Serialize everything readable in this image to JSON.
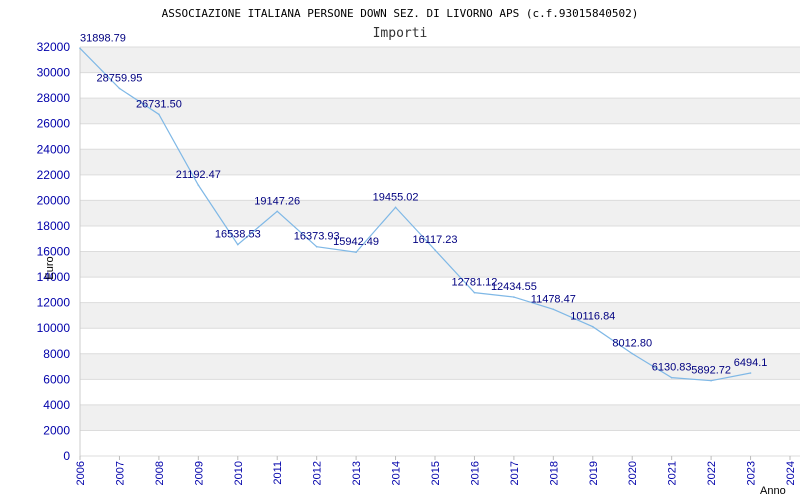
{
  "chart_data": {
    "type": "line",
    "title": "ASSOCIAZIONE ITALIANA PERSONE DOWN SEZ. DI LIVORNO APS (c.f.93015840502)",
    "subtitle": "Importi",
    "xlabel": "Anno",
    "ylabel": "Euro",
    "ylim": [
      0,
      32000
    ],
    "y_ticks": [
      0,
      2000,
      4000,
      6000,
      8000,
      10000,
      12000,
      14000,
      16000,
      18000,
      20000,
      22000,
      24000,
      26000,
      28000,
      30000,
      32000
    ],
    "grid": true,
    "legend": "none",
    "x": [
      "2006",
      "2007",
      "2008",
      "2009",
      "2010",
      "2011",
      "2012",
      "2013",
      "2014",
      "2015",
      "2016",
      "2017",
      "2018",
      "2019",
      "2020",
      "2021",
      "2022",
      "2023",
      "2024"
    ],
    "series": [
      {
        "values": [
          31898.79,
          28759.95,
          26731.5,
          21192.47,
          16538.53,
          19147.26,
          16373.93,
          15942.49,
          19455.02,
          16117.23,
          12781.12,
          12434.55,
          11478.47,
          10116.84,
          8012.8,
          6130.83,
          5892.72,
          6494.1
        ],
        "labels": [
          "31898.79",
          "28759.95",
          "26731.50",
          "21192.47",
          "16538.53",
          "19147.26",
          "16373.93",
          "15942.49",
          "19455.02",
          "16117.23",
          "12781.12",
          "12434.55",
          "11478.47",
          "10116.84",
          "8012.80",
          "6130.83",
          "5892.72",
          "6494.1"
        ],
        "color": "#7fb8e6"
      }
    ],
    "colors": {
      "band": "#f0f0f0",
      "grid": "#dcdcdc",
      "tick_text": "#0000aa",
      "label_text": "#000080"
    }
  }
}
